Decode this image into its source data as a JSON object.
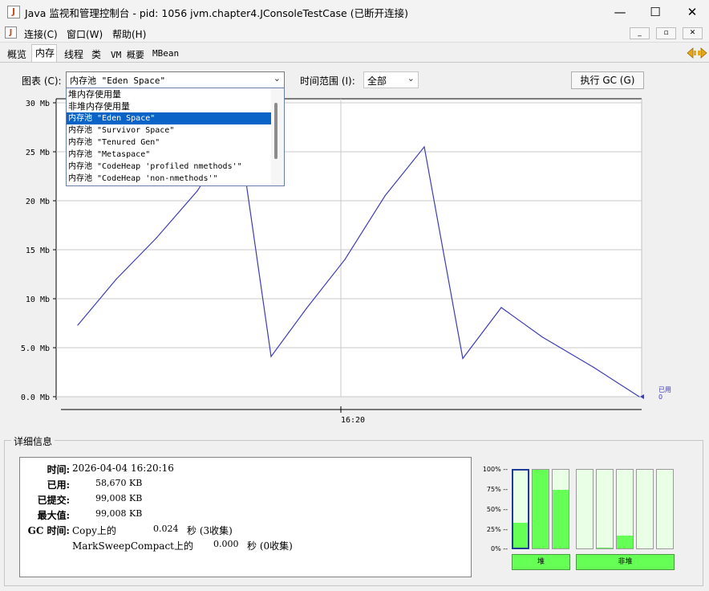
{
  "window": {
    "title": "Java 监视和管理控制台 - pid: 1056 jvm.chapter4.JConsoleTestCase (已断开连接)",
    "minimize": "—",
    "maximize": "☐",
    "close": "✕"
  },
  "menu": {
    "items": [
      "连接(C)",
      "窗口(W)",
      "帮助(H)"
    ],
    "mdi": [
      "_",
      "▫",
      "✕"
    ]
  },
  "tabs": [
    "概览",
    "内存",
    "线程",
    "类",
    "VM 概要",
    "MBean"
  ],
  "toolbar": {
    "chart_label": "图表 (C):",
    "chart_selected": "内存池 \"Eden Space\"",
    "range_label": "时间范围 (I):",
    "range_selected": "全部",
    "gc_button": "执行 GC (G)"
  },
  "dropdown": {
    "options": [
      "堆内存使用量",
      "非堆内存使用量",
      "内存池 \"Eden Space\"",
      "内存池 \"Survivor Space\"",
      "内存池 \"Tenured Gen\"",
      "内存池 \"Metaspace\"",
      "内存池 \"CodeHeap 'profiled nmethods'\"",
      "内存池 \"CodeHeap 'non-nmethods'\""
    ],
    "selected_index": 2
  },
  "chart_data": {
    "type": "line",
    "series": [
      {
        "name": "已用",
        "values": [
          7.3,
          12.0,
          16.2,
          21.0,
          27.5,
          4.1,
          9.0,
          14.0,
          20.5,
          25.5,
          3.9,
          9.1,
          6.1,
          3.0,
          0.0
        ],
        "color": "#3c3cb4"
      }
    ],
    "y_ticks": [
      "30 Mb",
      "25 Mb",
      "20 Mb",
      "15 Mb",
      "10 Mb",
      "5.0 Mb",
      "0.0 Mb"
    ],
    "ylim": [
      0,
      30
    ],
    "x_ticks": [
      "16:20"
    ],
    "legend": {
      "label": "已用",
      "value": "0"
    },
    "grid": true
  },
  "details": {
    "title": "详细信息",
    "time_label": "时间:",
    "time_value": "2026-04-04 16:20:16",
    "used_label": "已用:",
    "used_value": "58,670 KB",
    "committed_label": "已提交:",
    "committed_value": "99,008 KB",
    "max_label": "最大值:",
    "max_value": "99,008 KB",
    "gc_label": "GC 时间:",
    "gc1_name": "Copy上的",
    "gc1_time": "0.024",
    "gc1_unit": "秒 (3收集)",
    "gc2_name": "MarkSweepCompact上的",
    "gc2_time": "0.000",
    "gc2_unit": "秒 (0收集)"
  },
  "pool_bars": {
    "percent_labels": [
      "100% --",
      "75% --",
      "50% --",
      "25% --",
      "0% --"
    ],
    "heap_levels": [
      0.32,
      1.0,
      0.75
    ],
    "nonheap_levels": [
      0.0,
      0.01,
      0.16,
      0.0,
      0.0
    ],
    "heap_label": "堆",
    "nonheap_label": "非堆"
  }
}
